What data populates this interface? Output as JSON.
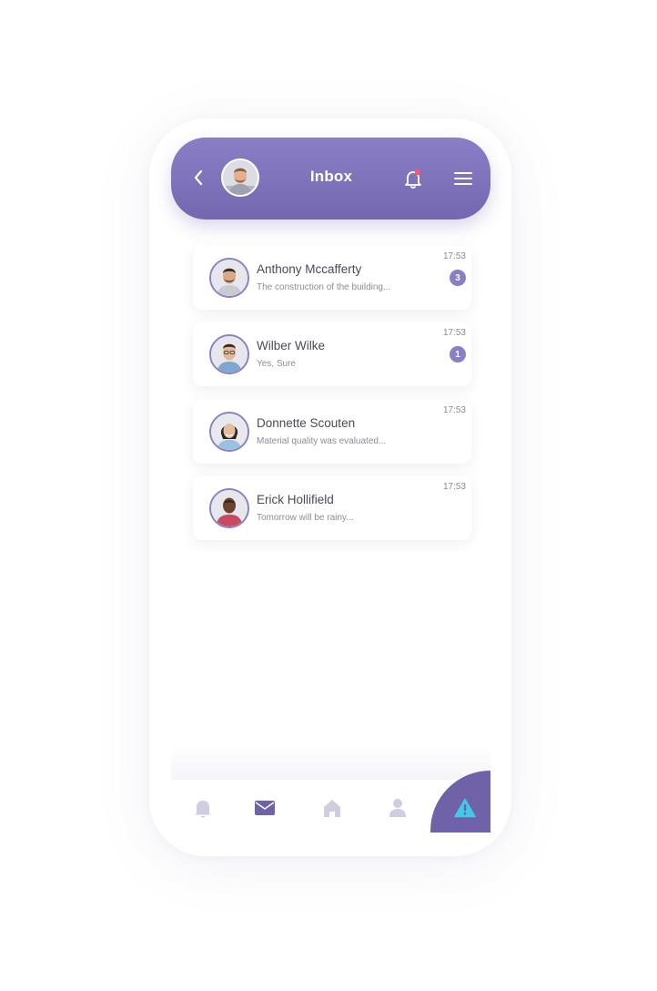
{
  "header": {
    "title": "Inbox",
    "bell_has_notification": true
  },
  "colors": {
    "header_start": "#8a7fc6",
    "header_end": "#7467b0",
    "badge": "#8a7fc6",
    "active_nav": "#6f62a8",
    "inactive_nav": "#cfcde0",
    "alert_icon": "#43c9e8",
    "notification_dot": "#ef5a6f"
  },
  "messages": [
    {
      "name": "Anthony Mccafferty",
      "preview": "The construction of the building...",
      "time": "17:53",
      "unread": "3"
    },
    {
      "name": "Wilber Wilke",
      "preview": "Yes, Sure",
      "time": "17:53",
      "unread": "1"
    },
    {
      "name": "Donnette Scouten",
      "preview": "Material quality was evaluated...",
      "time": "17:53",
      "unread": ""
    },
    {
      "name": "Erick Hollifield",
      "preview": "Tomorrow will be rainy...",
      "time": "17:53",
      "unread": ""
    }
  ],
  "bottom_nav": [
    {
      "icon": "bell-icon",
      "active": false
    },
    {
      "icon": "mail-icon",
      "active": true
    },
    {
      "icon": "home-icon",
      "active": false
    },
    {
      "icon": "user-icon",
      "active": false
    },
    {
      "icon": "warning-icon",
      "active": false
    }
  ]
}
